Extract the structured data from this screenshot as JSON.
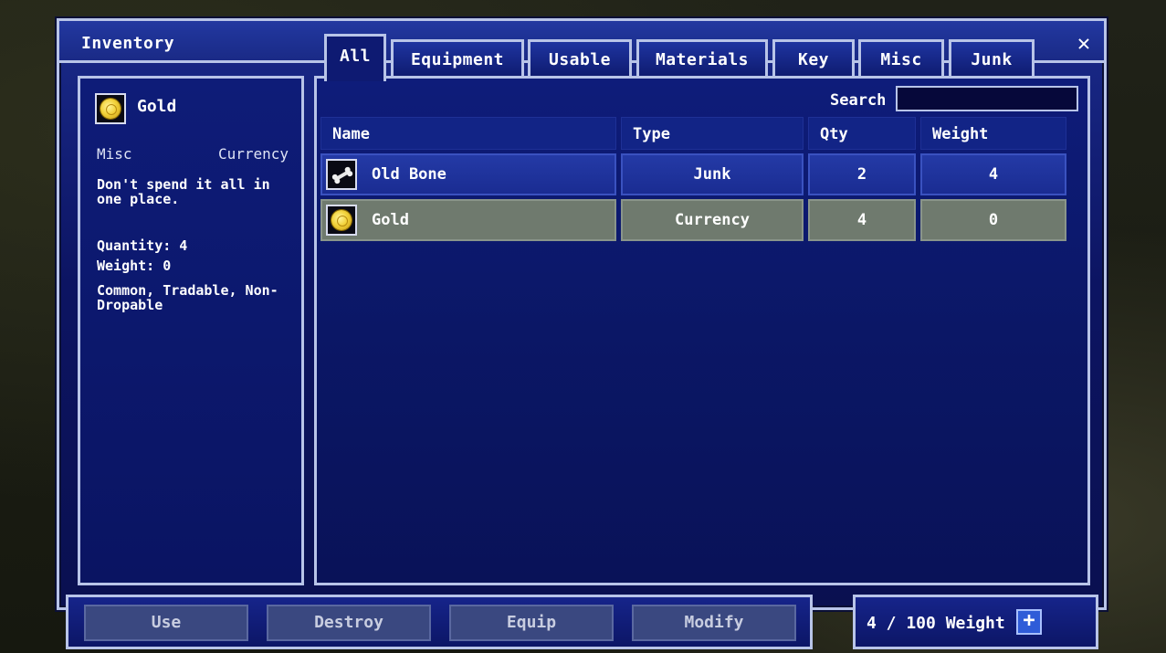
{
  "window": {
    "title": "Inventory"
  },
  "tabs": [
    {
      "label": "All",
      "active": true
    },
    {
      "label": "Equipment"
    },
    {
      "label": "Usable"
    },
    {
      "label": "Materials"
    },
    {
      "label": "Key"
    },
    {
      "label": "Misc"
    },
    {
      "label": "Junk"
    }
  ],
  "details": {
    "icon": "gold-coin-icon",
    "name": "Gold",
    "category": "Misc",
    "subcategory": "Currency",
    "description": "Don't spend it all in one place.",
    "quantity": "Quantity: 4",
    "weight": "Weight: 0",
    "flags": "Common, Tradable, Non-Dropable"
  },
  "search": {
    "label": "Search",
    "value": ""
  },
  "table": {
    "columns": [
      "Name",
      "Type",
      "Qty",
      "Weight"
    ],
    "rows": [
      {
        "icon": "bone-icon",
        "name": "Old Bone",
        "type": "Junk",
        "qty": "2",
        "weight": "4",
        "selected": false
      },
      {
        "icon": "gold-coin-icon",
        "name": "Gold",
        "type": "Currency",
        "qty": "4",
        "weight": "0",
        "selected": true
      }
    ]
  },
  "actions": [
    "Use",
    "Destroy",
    "Equip",
    "Modify"
  ],
  "weight_bar": {
    "text": "4 / 100 Weight",
    "plus_icon": "plus-icon"
  },
  "colors": {
    "window_bg": "#0c1462",
    "border": "#b8c4e8",
    "selected_row": "#6f7a6e",
    "disabled_button": "#3a4880"
  }
}
